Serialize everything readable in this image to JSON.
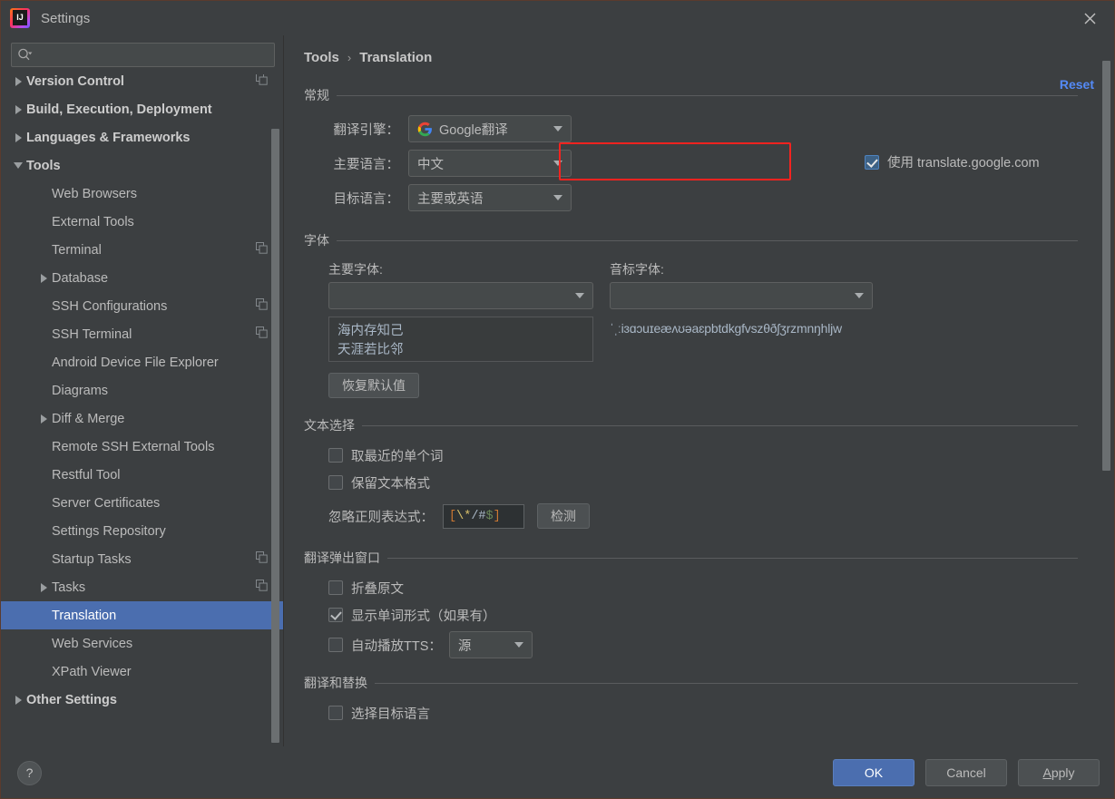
{
  "window": {
    "title": "Settings",
    "logo_icon": "intellij-idea-logo",
    "close_icon": "close-icon"
  },
  "sidebar": {
    "search": {
      "placeholder": "",
      "value": "",
      "icon": "search-icon"
    },
    "items": [
      {
        "label": "Version Control",
        "arrow": "right",
        "bold": true,
        "indent": 0,
        "copy": true
      },
      {
        "label": "Build, Execution, Deployment",
        "arrow": "right",
        "bold": true,
        "indent": 0,
        "copy": false
      },
      {
        "label": "Languages & Frameworks",
        "arrow": "right",
        "bold": true,
        "indent": 0,
        "copy": false
      },
      {
        "label": "Tools",
        "arrow": "down",
        "bold": true,
        "indent": 0,
        "copy": false
      },
      {
        "label": "Web Browsers",
        "arrow": "none",
        "bold": false,
        "indent": 1,
        "copy": false
      },
      {
        "label": "External Tools",
        "arrow": "none",
        "bold": false,
        "indent": 1,
        "copy": false
      },
      {
        "label": "Terminal",
        "arrow": "none",
        "bold": false,
        "indent": 1,
        "copy": true
      },
      {
        "label": "Database",
        "arrow": "right",
        "bold": false,
        "indent": 1,
        "copy": false
      },
      {
        "label": "SSH Configurations",
        "arrow": "none",
        "bold": false,
        "indent": 1,
        "copy": true
      },
      {
        "label": "SSH Terminal",
        "arrow": "none",
        "bold": false,
        "indent": 1,
        "copy": true
      },
      {
        "label": "Android Device File Explorer",
        "arrow": "none",
        "bold": false,
        "indent": 1,
        "copy": false
      },
      {
        "label": "Diagrams",
        "arrow": "none",
        "bold": false,
        "indent": 1,
        "copy": false
      },
      {
        "label": "Diff & Merge",
        "arrow": "right",
        "bold": false,
        "indent": 1,
        "copy": false
      },
      {
        "label": "Remote SSH External Tools",
        "arrow": "none",
        "bold": false,
        "indent": 1,
        "copy": false
      },
      {
        "label": "Restful Tool",
        "arrow": "none",
        "bold": false,
        "indent": 1,
        "copy": false
      },
      {
        "label": "Server Certificates",
        "arrow": "none",
        "bold": false,
        "indent": 1,
        "copy": false
      },
      {
        "label": "Settings Repository",
        "arrow": "none",
        "bold": false,
        "indent": 1,
        "copy": false
      },
      {
        "label": "Startup Tasks",
        "arrow": "none",
        "bold": false,
        "indent": 1,
        "copy": true
      },
      {
        "label": "Tasks",
        "arrow": "right",
        "bold": false,
        "indent": 1,
        "copy": true
      },
      {
        "label": "Translation",
        "arrow": "none",
        "bold": false,
        "indent": 1,
        "copy": false,
        "selected": true
      },
      {
        "label": "Web Services",
        "arrow": "none",
        "bold": false,
        "indent": 1,
        "copy": false
      },
      {
        "label": "XPath Viewer",
        "arrow": "none",
        "bold": false,
        "indent": 1,
        "copy": false
      },
      {
        "label": "Other Settings",
        "arrow": "right",
        "bold": true,
        "indent": 0,
        "copy": false
      }
    ]
  },
  "content": {
    "breadcrumb": {
      "parent": "Tools",
      "separator": "›",
      "current": "Translation"
    },
    "reset_label": "Reset",
    "general": {
      "title": "常规",
      "engine_label": "翻译引擎：",
      "engine_value": "Google翻译",
      "engine_icon": "google-icon",
      "primary_lang_label": "主要语言：",
      "primary_lang_value": "中文",
      "target_lang_label": "目标语言：",
      "target_lang_value": "主要或英语",
      "use_translate_google_label": "使用 translate.google.com",
      "use_translate_google_checked": true,
      "highlight_color": "#f5231f"
    },
    "fonts": {
      "title": "字体",
      "primary_font_label": "主要字体:",
      "primary_font_value": "",
      "phonetic_font_label": "音标字体:",
      "phonetic_font_value": "",
      "preview_line1": "海内存知己",
      "preview_line2": "天涯若比邻",
      "phonetic_preview": "ˈˌːiɜɑɔuɪeæʌʊəaɛpbtdkgfvszθðʃʒrzmnŋhljw",
      "restore_default_label": "恢复默认值"
    },
    "text_selection": {
      "title": "文本选择",
      "nearest_word_label": "取最近的单个词",
      "nearest_word_checked": false,
      "keep_format_label": "保留文本格式",
      "keep_format_checked": false,
      "regex_label": "忽略正则表达式：",
      "regex_value": "[\\*/#$]",
      "regex_parts": {
        "open": "[",
        "escape": "\\*",
        "plain": "/#",
        "anchor": "$",
        "close": "]"
      },
      "detect_label": "检测"
    },
    "popup": {
      "title": "翻译弹出窗口",
      "fold_source_label": "折叠原文",
      "fold_source_checked": false,
      "show_word_forms_label": "显示单词形式（如果有）",
      "show_word_forms_checked": true,
      "auto_tts_label": "自动播放TTS：",
      "auto_tts_checked": false,
      "tts_value": "源"
    },
    "replace": {
      "title": "翻译和替换",
      "select_target_lang_label": "选择目标语言",
      "select_target_lang_checked": false
    }
  },
  "footer": {
    "help_label": "?",
    "ok_label": "OK",
    "cancel_label": "Cancel",
    "apply_label_first": "A",
    "apply_label_rest": "pply"
  }
}
